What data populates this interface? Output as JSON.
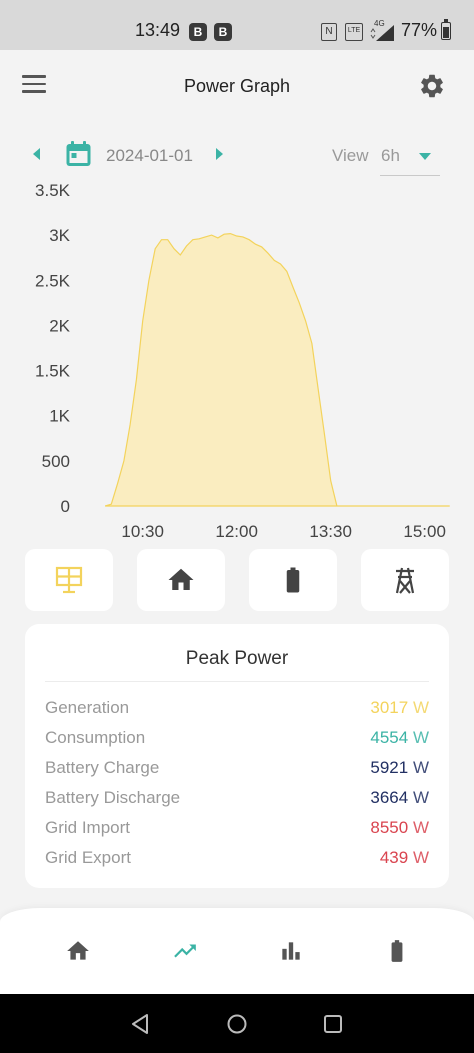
{
  "status_bar": {
    "time": "13:49",
    "badges": [
      "B",
      "B"
    ],
    "nfc": "N",
    "volte": "LTE",
    "network": "4G",
    "battery": "77%"
  },
  "header": {
    "title": "Power Graph",
    "menu_icon": "menu-icon",
    "settings_icon": "gear-icon"
  },
  "date_bar": {
    "date": "2024-01-01",
    "view_label": "View",
    "view_value": "6h"
  },
  "colors": {
    "accent": "#3bb3a5",
    "generation": "#f3d35c",
    "generation_fill": "#faedc0",
    "consumption": "#3bb3a5",
    "battery": "#223063",
    "grid": "#d9444f"
  },
  "chart_data": {
    "type": "area",
    "series": [
      {
        "x": [
          "09:54",
          "10:00",
          "10:06",
          "10:12",
          "10:18",
          "10:24",
          "10:30",
          "10:36",
          "10:42",
          "10:48",
          "10:54",
          "11:00",
          "11:06",
          "11:12",
          "11:18",
          "11:24",
          "11:30",
          "11:36",
          "11:42",
          "11:48",
          "11:54",
          "12:00",
          "12:06",
          "12:12",
          "12:18",
          "12:24",
          "12:30",
          "12:36",
          "12:42",
          "12:48",
          "12:54",
          "13:00",
          "13:06",
          "13:12",
          "13:18",
          "13:24",
          "13:30",
          "13:36",
          "13:42",
          "13:48",
          "13:54",
          "14:00",
          "14:06",
          "14:12",
          "14:18",
          "14:24",
          "14:30",
          "14:36",
          "14:42",
          "14:48",
          "14:54",
          "15:00",
          "15:06",
          "15:12",
          "15:18",
          "15:24"
        ],
        "y": [
          0,
          20,
          250,
          500,
          900,
          1400,
          2050,
          2500,
          2850,
          2950,
          2950,
          2850,
          2780,
          2880,
          2950,
          2960,
          2980,
          3000,
          2970,
          3010,
          3017,
          2990,
          2980,
          2950,
          2900,
          2870,
          2800,
          2720,
          2680,
          2600,
          2420,
          2250,
          2050,
          1800,
          1300,
          800,
          280,
          0,
          0,
          0,
          0,
          0,
          0,
          0,
          0,
          0,
          0,
          0,
          0,
          0,
          0,
          0,
          0,
          0,
          0,
          0
        ]
      }
    ],
    "x_ticks": [
      "10:30",
      "12:00",
      "13:30",
      "15:00"
    ],
    "y_ticks": [
      "0",
      "500",
      "1K",
      "1.5K",
      "2K",
      "2.5K",
      "3K",
      "3.5K"
    ],
    "ylim": [
      0,
      3500
    ],
    "grid": false
  },
  "categories": [
    {
      "name": "solar",
      "icon": "solar-panel-icon"
    },
    {
      "name": "home",
      "icon": "home-icon"
    },
    {
      "name": "battery",
      "icon": "battery-icon"
    },
    {
      "name": "grid",
      "icon": "power-pylon-icon"
    }
  ],
  "peak_power": {
    "title": "Peak Power",
    "rows": [
      {
        "label": "Generation",
        "value": "3017",
        "unit": "W",
        "color": "#f3d35c"
      },
      {
        "label": "Consumption",
        "value": "4554",
        "unit": "W",
        "color": "#3bb3a5"
      },
      {
        "label": "Battery Charge",
        "value": "5921",
        "unit": "W",
        "color": "#223063"
      },
      {
        "label": "Battery Discharge",
        "value": "3664",
        "unit": "W",
        "color": "#223063"
      },
      {
        "label": "Grid Import",
        "value": "8550",
        "unit": "W",
        "color": "#d9444f"
      },
      {
        "label": "Grid Export",
        "value": "439",
        "unit": "W",
        "color": "#d9444f"
      }
    ]
  },
  "bottom_nav": [
    {
      "name": "home",
      "icon": "home-icon"
    },
    {
      "name": "graph",
      "icon": "trending-up-icon",
      "active": true
    },
    {
      "name": "stats",
      "icon": "bar-chart-icon"
    },
    {
      "name": "battery",
      "icon": "battery-icon"
    }
  ]
}
